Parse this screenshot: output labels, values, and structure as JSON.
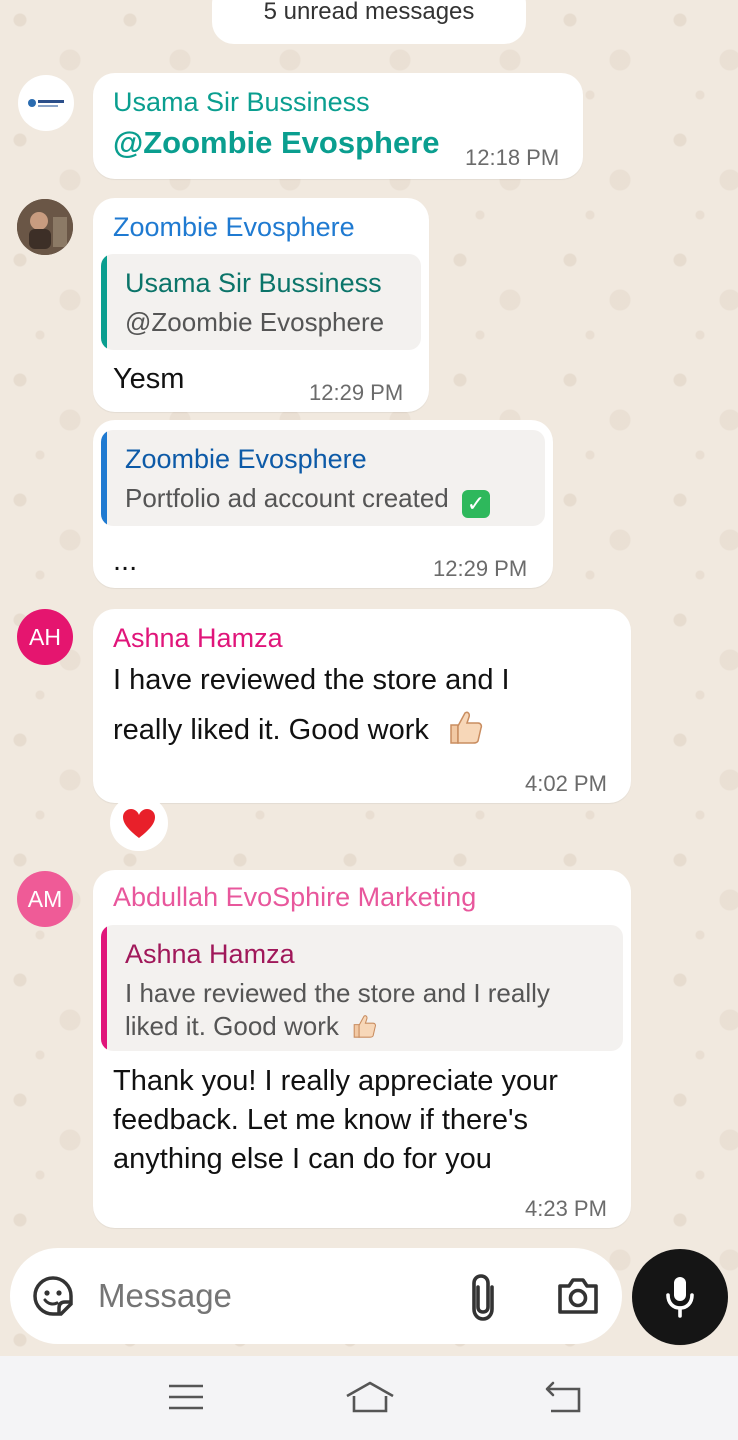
{
  "unread_label": "5 unread messages",
  "messages": [
    {
      "sender": "Usama Sir Bussiness",
      "sender_color": "#0a9e8f",
      "text": "@Zoombie Evosphere",
      "time": "12:18 PM"
    },
    {
      "sender": "Zoombie Evosphere",
      "sender_color": "#1f7ad1",
      "quote": {
        "name": "Usama Sir Bussiness",
        "text": "@Zoombie Evosphere"
      },
      "text": "Yesm",
      "time": "12:29 PM"
    },
    {
      "quote": {
        "name": "Zoombie Evosphere",
        "text": "Portfolio ad account created"
      },
      "text": "...",
      "time": "12:29 PM"
    },
    {
      "avatar_initials": "AH",
      "sender": "Ashna Hamza",
      "sender_color": "#e0157a",
      "text_line1": "I have reviewed the store and I",
      "text_line2": "really liked it. Good work",
      "time": "4:02 PM",
      "reaction": "red-heart"
    },
    {
      "avatar_initials": "AM",
      "sender": "Abdullah EvoSphire Marketing",
      "sender_color": "#e8579c",
      "quote": {
        "name": "Ashna Hamza",
        "text_line1": "I have reviewed the store and I really",
        "text_line2": "liked it. Good work"
      },
      "text_line1": "Thank you! I really appreciate your",
      "text_line2": "feedback. Let me know if there's",
      "text_line3": "anything else I can do for you",
      "time": "4:23 PM"
    }
  ],
  "composer": {
    "placeholder": "Message",
    "icons": [
      "sticker-icon",
      "paperclip-icon",
      "camera-icon",
      "microphone-icon"
    ]
  },
  "nav": {
    "icons": [
      "recent-apps-icon",
      "home-icon",
      "back-icon"
    ]
  }
}
